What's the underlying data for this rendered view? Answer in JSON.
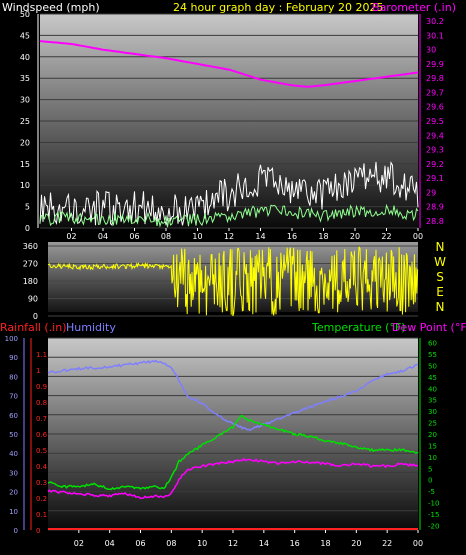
{
  "header": {
    "left_label": "Windspeed (mph)",
    "title": "24 hour graph day : February 20 2025",
    "right_label": "Barometer (.in)"
  },
  "direction_letters": [
    "N",
    "W",
    "S",
    "E",
    "N"
  ],
  "bottom_header": {
    "rain_label": "Rainfall (.in)",
    "humidity_label": "Humidity",
    "temp_label": "Temperature (°F)",
    "dew_label": "Dew Point (°F)"
  },
  "colors": {
    "background": "#000000",
    "wind_axis": "#ffffff",
    "barometer": "#ff00ff",
    "direction": "#ffff00",
    "rain": "#ff2020",
    "humidity": "#7f7fff",
    "temperature": "#00e000",
    "dew_point": "#ff00ff",
    "title": "#ffff00",
    "wind_avg": "#90ff90",
    "wind_gust": "#ffffff"
  },
  "chart_data": [
    {
      "type": "line",
      "title": "24 hour graph day : February 20 2025",
      "x_ticks": [
        "02",
        "04",
        "06",
        "08",
        "10",
        "12",
        "14",
        "16",
        "18",
        "20",
        "22",
        "00"
      ],
      "y_left": {
        "label": "Windspeed (mph)",
        "ticks": [
          0,
          5,
          10,
          15,
          20,
          25,
          30,
          35,
          40,
          45,
          50
        ],
        "range": [
          0,
          50
        ]
      },
      "y_right": {
        "label": "Barometer (.in)",
        "ticks": [
          "28.8",
          "28.9",
          "29",
          "29.1",
          "29.2",
          "29.3",
          "29.4",
          "29.5",
          "29.6",
          "29.7",
          "29.8",
          "29.9",
          "30",
          "30.1",
          "30.2"
        ],
        "range": [
          28.75,
          30.25
        ]
      },
      "series": [
        {
          "name": "Barometer (.in)",
          "axis": "right",
          "hours": [
            0,
            2,
            4,
            6,
            8,
            10,
            12,
            14,
            16,
            17,
            18,
            20,
            22,
            24
          ],
          "values": [
            30.06,
            30.04,
            30.0,
            29.97,
            29.94,
            29.9,
            29.86,
            29.79,
            29.75,
            29.74,
            29.75,
            29.78,
            29.81,
            29.84
          ]
        },
        {
          "axis": "left",
          "hours": [
            0,
            2,
            4,
            6,
            8,
            10,
            12,
            14,
            16,
            18,
            20,
            22,
            24
          ],
          "values": [
            2,
            2.5,
            2,
            2.5,
            1.5,
            2,
            3,
            4,
            3.5,
            3,
            4,
            4,
            3
          ]
        },
        {
          "axis": "left",
          "hours": [
            0,
            2,
            4,
            6,
            8,
            10,
            12,
            14,
            16,
            18,
            20,
            22,
            24
          ],
          "values": [
            5,
            5,
            4.5,
            5,
            4,
            5,
            8,
            11,
            9,
            8,
            11,
            12,
            8
          ]
        }
      ]
    },
    {
      "type": "line",
      "y_ticks": [
        "0",
        "90",
        "180",
        "270",
        "360"
      ],
      "range": [
        0,
        360
      ],
      "series": [
        {
          "hours": [
            0,
            2,
            4,
            6,
            7.9
          ],
          "values": [
            260,
            250,
            255,
            258,
            250
          ]
        },
        {
          "hours": [
            8,
            24
          ],
          "values": [
            0,
            360
          ]
        }
      ]
    },
    {
      "type": "line",
      "x_ticks": [
        "02",
        "04",
        "06",
        "08",
        "10",
        "12",
        "14",
        "16",
        "18",
        "20",
        "22",
        "00"
      ],
      "y_humidity": {
        "label": "Humidity",
        "ticks": [
          0,
          10,
          20,
          30,
          40,
          50,
          60,
          70,
          80,
          90,
          100
        ],
        "range": [
          0,
          100
        ]
      },
      "y_rain": {
        "label": "Rainfall (.in)",
        "ticks": [
          "0",
          "0.1",
          "0.2",
          "0.3",
          "0.4",
          "0.5",
          "0.6",
          "0.7",
          "0.8",
          "0.9",
          "1",
          "1.1"
        ],
        "range": [
          0,
          1.2
        ]
      },
      "y_temp": {
        "label": "Temperature (°F)",
        "ticks": [
          "-20",
          "-15",
          "-10",
          "-5",
          "0",
          "5",
          "10",
          "15",
          "20",
          "25",
          "30",
          "35",
          "40",
          "45",
          "50",
          "55",
          "60"
        ],
        "range": [
          -22,
          62
        ]
      },
      "series": [
        {
          "name": "Humidity",
          "axis": "humidity",
          "hours": [
            0,
            2,
            4,
            6,
            7,
            7.5,
            8,
            8.5,
            9,
            10,
            11,
            12,
            13,
            14,
            16,
            18,
            20,
            21,
            22,
            23,
            24
          ],
          "values": [
            82,
            84,
            85,
            87,
            88,
            87,
            85,
            78,
            70,
            66,
            60,
            55,
            52,
            55,
            61,
            67,
            72,
            78,
            81,
            83,
            86
          ]
        },
        {
          "name": "Temperature (°F)",
          "axis": "temp",
          "hours": [
            0,
            1,
            2,
            3,
            4,
            5,
            6,
            7,
            7.5,
            8,
            8.5,
            9,
            10,
            11,
            12,
            12.5,
            13,
            14,
            15,
            16,
            17,
            18,
            19,
            20,
            21,
            22,
            23,
            24
          ],
          "values": [
            -1,
            -3,
            -3,
            -2,
            -4,
            -3,
            -4,
            -3,
            -4,
            1,
            8,
            11,
            15,
            19,
            23,
            28,
            26,
            24,
            22,
            20,
            19,
            17,
            16,
            14,
            13,
            13,
            13,
            12
          ]
        },
        {
          "name": "Dew Point (°F)",
          "axis": "temp",
          "hours": [
            0,
            2,
            3,
            4,
            5,
            6,
            7,
            7.5,
            8,
            8.5,
            9,
            10,
            11,
            12,
            13,
            14,
            15,
            16,
            18,
            19,
            20,
            21,
            22,
            23,
            24
          ],
          "values": [
            -5,
            -6,
            -7,
            -7,
            -6,
            -8,
            -7,
            -8,
            -6,
            0,
            4,
            6,
            7,
            8,
            9,
            8,
            7,
            8,
            7,
            6,
            7,
            6,
            6,
            7,
            6
          ]
        },
        {
          "name": "Rainfall (.in)",
          "axis": "rain",
          "hours": [
            0,
            24
          ],
          "values": [
            0,
            0
          ]
        }
      ]
    }
  ]
}
